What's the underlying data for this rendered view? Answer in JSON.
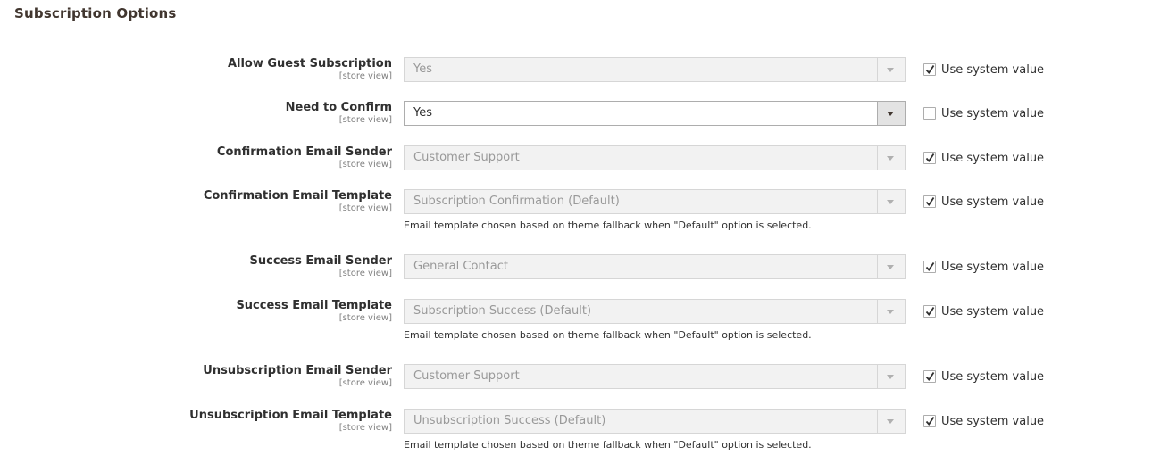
{
  "section": {
    "title": "Subscription Options"
  },
  "system_value_label": "Use system value",
  "fields": [
    {
      "label": "Allow Guest Subscription",
      "scope": "[store view]",
      "value": "Yes",
      "use_system": true,
      "note": ""
    },
    {
      "label": "Need to Confirm",
      "scope": "[store view]",
      "value": "Yes",
      "use_system": false,
      "note": ""
    },
    {
      "label": "Confirmation Email Sender",
      "scope": "[store view]",
      "value": "Customer Support",
      "use_system": true,
      "note": ""
    },
    {
      "label": "Confirmation Email Template",
      "scope": "[store view]",
      "value": "Subscription Confirmation (Default)",
      "use_system": true,
      "note": "Email template chosen based on theme fallback when \"Default\" option is selected."
    },
    {
      "label": "Success Email Sender",
      "scope": "[store view]",
      "value": "General Contact",
      "use_system": true,
      "note": ""
    },
    {
      "label": "Success Email Template",
      "scope": "[store view]",
      "value": "Subscription Success (Default)",
      "use_system": true,
      "note": "Email template chosen based on theme fallback when \"Default\" option is selected."
    },
    {
      "label": "Unsubscription Email Sender",
      "scope": "[store view]",
      "value": "Customer Support",
      "use_system": true,
      "note": ""
    },
    {
      "label": "Unsubscription Email Template",
      "scope": "[store view]",
      "value": "Unsubscription Success (Default)",
      "use_system": true,
      "note": "Email template chosen based on theme fallback when \"Default\" option is selected."
    }
  ]
}
